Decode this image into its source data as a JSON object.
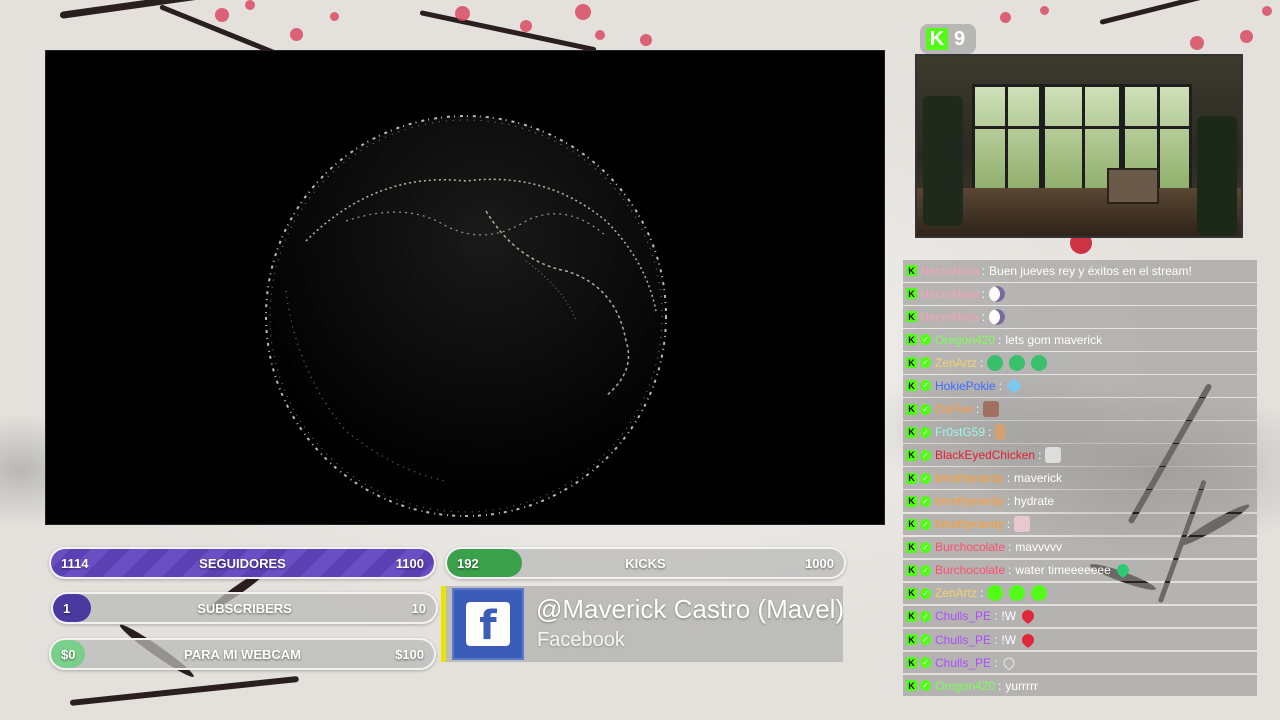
{
  "overlay": {
    "bars": {
      "followers": {
        "current": "1114",
        "label": "SEGUIDORES",
        "goal": "1100",
        "fill_fraction": 1.0
      },
      "kicks": {
        "current": "192",
        "label": "KICKS",
        "goal": "1000",
        "fill_fraction": 0.19
      },
      "subscribers": {
        "current": "1",
        "label": "SUBSCRIBERS",
        "goal": "10",
        "fill_fraction": 0.1
      },
      "webcam": {
        "current": "$0",
        "label": "PARA MI WEBCAM",
        "goal": "$100",
        "fill_fraction": 0.0
      }
    },
    "social": {
      "icon": "facebook-logo",
      "handle": "@Maverick Castro  (Mavel)",
      "platform": "Facebook"
    },
    "viewers": {
      "icon": "kick-logo-icon",
      "count": "9"
    }
  },
  "chat": {
    "messages": [
      {
        "user": "NecroNixia",
        "user_color": "#f4a3b8",
        "verified": false,
        "text": "Buen jueves rey y éxitos en el stream!",
        "emotes": []
      },
      {
        "user": "NecroNixia",
        "user_color": "#f4a3b8",
        "verified": false,
        "text": "",
        "emotes": [
          "moon-emote"
        ]
      },
      {
        "user": "NecroNixia",
        "user_color": "#f4a3b8",
        "verified": false,
        "text": "",
        "emotes": [
          "moon-emote"
        ]
      },
      {
        "user": "Oregon420",
        "user_color": "#7dff5a",
        "verified": true,
        "text": "lets gom maverick",
        "emotes": []
      },
      {
        "user": "ZenArtz",
        "user_color": "#f3d36b",
        "verified": true,
        "text": "",
        "emotes": [
          "alien-emote",
          "alien-emote",
          "alien-emote"
        ]
      },
      {
        "user": "HokiePokie",
        "user_color": "#3f6bff",
        "verified": true,
        "text": "",
        "emotes": [
          "gem-emote"
        ]
      },
      {
        "user": "OxFive",
        "user_color": "#ff9b3d",
        "verified": true,
        "text": "",
        "emotes": [
          "face-emote"
        ]
      },
      {
        "user": "Fr0stG59",
        "user_color": "#9ff5e8",
        "verified": true,
        "text": "",
        "emotes": [
          "figure-emote"
        ]
      },
      {
        "user": "BlackEyedChicken",
        "user_color": "#e0202e",
        "verified": true,
        "text": "",
        "emotes": [
          "crown-emote"
        ]
      },
      {
        "user": "timothyrandy",
        "user_color": "#ff9c2e",
        "verified": true,
        "text": "maverick",
        "emotes": []
      },
      {
        "user": "timothyrandy",
        "user_color": "#ff9c2e",
        "verified": true,
        "text": "hydrate",
        "emotes": []
      },
      {
        "user": "timothyrandy",
        "user_color": "#ff9c2e",
        "verified": true,
        "text": "",
        "emotes": [
          "anime-emote"
        ]
      },
      {
        "user": "Burchocolate",
        "user_color": "#ff4f6e",
        "verified": true,
        "text": "mavvvvv",
        "emotes": []
      },
      {
        "user": "Burchocolate",
        "user_color": "#ff4f6e",
        "verified": true,
        "text": "water timeeeeeee",
        "emotes": [
          "green-heart-emote"
        ]
      },
      {
        "user": "ZenArtz",
        "user_color": "#f3d36b",
        "verified": true,
        "text": "",
        "emotes": [
          "smile-emote",
          "smile-emote",
          "smile-emote"
        ]
      },
      {
        "user": "Chulls_PE",
        "user_color": "#b04bff",
        "verified": true,
        "text": "!W",
        "emotes": [
          "red-heart-emote"
        ]
      },
      {
        "user": "Chulls_PE",
        "user_color": "#b04bff",
        "verified": true,
        "text": "!W",
        "emotes": [
          "red-heart-emote"
        ]
      },
      {
        "user": "Chulls_PE",
        "user_color": "#b04bff",
        "verified": true,
        "text": "",
        "emotes": [
          "outline-heart-emote"
        ]
      },
      {
        "user": "Oregon420",
        "user_color": "#7dff5a",
        "verified": true,
        "text": "yurrrrr",
        "emotes": []
      }
    ]
  },
  "colors": {
    "kick_green": "#53fc18",
    "follower_bar": "#6a4fc4",
    "facebook_blue": "#3b5db8",
    "accent_yellow": "#e6e600"
  }
}
